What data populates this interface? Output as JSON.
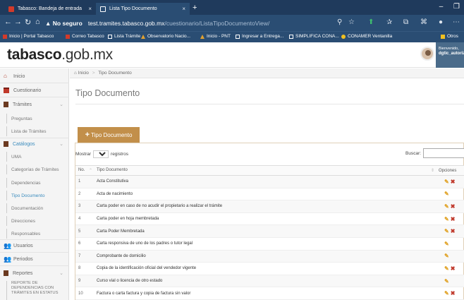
{
  "browser": {
    "tabs": [
      {
        "title": "Tabasco: Bandeja de entrada",
        "close": "×"
      },
      {
        "title": "Lista Tipo Documento",
        "close": "×"
      }
    ],
    "new_tab": "+",
    "window_controls": [
      "–",
      "❐"
    ],
    "nav": [
      "←",
      "→",
      "↻",
      "⌂"
    ],
    "security": "▲ No seguro",
    "url_host": "test.tramites.tabasco.gob.mx",
    "url_path": "/cuestionario/ListaTipoDocumentoView/",
    "bookmarks": [
      {
        "label": "Inicio | Portal Tabasco",
        "icon": "red"
      },
      {
        "label": "Correo Tabasco",
        "icon": "red"
      },
      {
        "label": "Lista Trámite",
        "icon": "doc"
      },
      {
        "label": "Observatorio Nacio...",
        "icon": "tri"
      },
      {
        "label": "Inicio - PNT",
        "icon": "tri"
      },
      {
        "label": "Ingresar a Entrega...",
        "icon": "doc"
      },
      {
        "label": "SIMPLIFICA CONA...",
        "icon": "doc"
      },
      {
        "label": "CONAMER Ventanilla",
        "icon": "mgr"
      },
      {
        "label": "Otros",
        "icon": "fold"
      }
    ]
  },
  "header": {
    "logo_main": "tabasco",
    "logo_suffix": ".gob.mx",
    "welcome": "Bienvenido,",
    "username": "dgtic_autoriza"
  },
  "sidebar": {
    "items": [
      {
        "label": "Inicio",
        "kind": "top",
        "icon": "home-icon"
      },
      {
        "label": "Cuestionario",
        "kind": "top",
        "icon": "calendar-icon"
      },
      {
        "label": "Trámites",
        "kind": "top",
        "icon": "file-icon",
        "chev": "⌄"
      },
      {
        "label": "Preguntas",
        "kind": "sub"
      },
      {
        "label": "Lista de Trámites",
        "kind": "sub"
      },
      {
        "label": "Catálogos",
        "kind": "top",
        "icon": "file-icon",
        "chev": "⌄",
        "active": true
      },
      {
        "label": "UMA",
        "kind": "sub"
      },
      {
        "label": "Categorías de Trámites",
        "kind": "sub"
      },
      {
        "label": "Dependencias",
        "kind": "sub"
      },
      {
        "label": "Tipo Documento",
        "kind": "sub",
        "active": true
      },
      {
        "label": "Documentación",
        "kind": "sub"
      },
      {
        "label": "Direcciones",
        "kind": "sub"
      },
      {
        "label": "Responsables",
        "kind": "sub"
      },
      {
        "label": "Usuarios",
        "kind": "top",
        "icon": "users-icon"
      },
      {
        "label": "Periodos",
        "kind": "top",
        "icon": "users-icon"
      },
      {
        "label": "Reportes",
        "kind": "top",
        "icon": "file-icon",
        "chev": "⌄"
      },
      {
        "label": "REPORTE DE DEPENDENCIAS CON TRÁMITES EN ESTATUS",
        "kind": "sub"
      }
    ]
  },
  "breadcrumb": {
    "home": "Inicio",
    "sep": ">",
    "current": "Tipo Documento"
  },
  "page": {
    "title": "Tipo Documento",
    "add_button": "Tipo Documento",
    "add_plus": "+",
    "show_label": "Mostrar",
    "show_value": "10",
    "records_label": "registros",
    "search_label": "Buscar:"
  },
  "table": {
    "headers": {
      "num": "No.",
      "name": "Tipo Documento",
      "ops": "Opciones"
    },
    "rows": [
      {
        "n": "1",
        "name": "Acta Constitutiva",
        "delete": true
      },
      {
        "n": "2",
        "name": "Acta de nacimiento",
        "delete": false
      },
      {
        "n": "3",
        "name": "Carta poder en caso de no acudir el propietario a realizar el trámite",
        "delete": true
      },
      {
        "n": "4",
        "name": "Carta poder en hoja membretada",
        "delete": true
      },
      {
        "n": "5",
        "name": "Carta Poder Membretada",
        "delete": true
      },
      {
        "n": "6",
        "name": "Carta responsiva de uno de los padres o tutor legal",
        "delete": false
      },
      {
        "n": "7",
        "name": "Comprobante de domicilio",
        "delete": false
      },
      {
        "n": "8",
        "name": "Copia de la identificación oficial del vendedor vigente",
        "delete": true
      },
      {
        "n": "9",
        "name": "Curso vial o licencia de otro estado",
        "delete": false
      },
      {
        "n": "10",
        "name": "Factura o carta factura y copia de factura sin valor",
        "delete": true
      }
    ]
  },
  "colors": {
    "accent": "#c28f4a",
    "chrome": "#2a4d73",
    "danger": "#c0392b",
    "edit": "#e0a020"
  }
}
